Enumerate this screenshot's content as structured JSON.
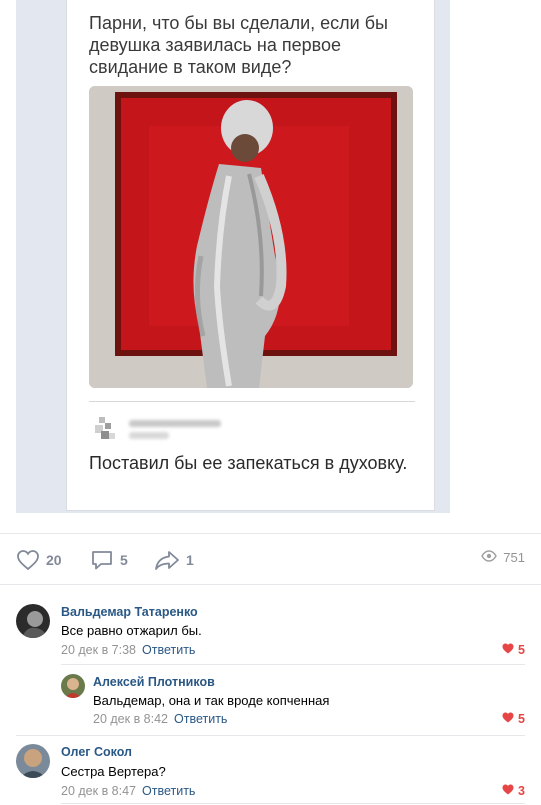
{
  "post": {
    "meme_question": "Парни, что бы вы сделали, если бы девушка заявилась на первое свидание в таком виде?",
    "meme_answer": "Поставил бы ее запекаться в духовку."
  },
  "actions": {
    "likes": "20",
    "comments": "5",
    "shares": "1",
    "views": "751"
  },
  "comments": [
    {
      "author": "Вальдемар Татаренко",
      "text": "Все равно отжарил бы.",
      "date": "20 дек в 7:38",
      "reply_label": "Ответить",
      "likes": "5"
    },
    {
      "author": "Алексей Плотников",
      "text": "Вальдемар, она и так вроде копченная",
      "date": "20 дек в 8:42",
      "reply_label": "Ответить",
      "likes": "5"
    },
    {
      "author": "Олег Сокол",
      "text": "Сестра Вертера?",
      "date": "20 дек в 8:47",
      "reply_label": "Ответить",
      "likes": "3"
    }
  ],
  "colors": {
    "link": "#2a5885",
    "meta": "#939393",
    "like_red": "#e64646",
    "icon_gray": "#828a99"
  },
  "icons": [
    "heart-icon",
    "comment-icon",
    "share-icon",
    "eye-icon"
  ]
}
